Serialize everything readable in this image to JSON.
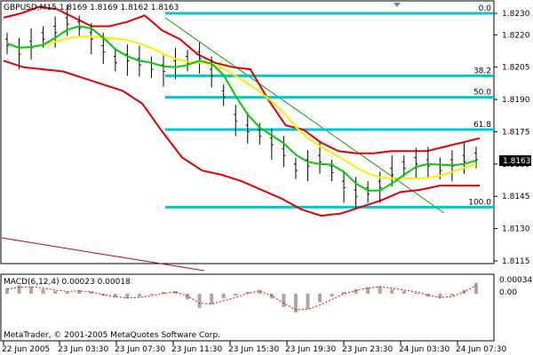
{
  "header": {
    "symbol_info": "GBPUSD,M15  1.8169 1.8169 1.8162 1.8163"
  },
  "indicator": {
    "label": "MACD(6,12,4) 0.00023 0.00018",
    "levels": [
      "0.00034",
      "0.00"
    ]
  },
  "footer": {
    "copyright": "MetaTrader, © 2001-2005 MetaQuotes Software Corp."
  },
  "current_price": "1.8163",
  "colors": {
    "fibo": "#00c8d0",
    "bands": "#e00000",
    "ma_fast": "#00cc00",
    "ma_slow": "#ffee00",
    "candles": "#000000",
    "trendline_green": "#00a000",
    "trendline_red": "#c00000",
    "macd_hist": "#a8a8a8",
    "macd_signal": "#e00000"
  },
  "chart_data": [
    {
      "type": "line",
      "series_visual": "OHLC bars with Bollinger bands, moving averages and Fibonacci retracement levels",
      "x_tick_labels": [
        "22 Jun 2005",
        "23 Jun 03:30",
        "23 Jun 07:30",
        "23 Jun 11:30",
        "23 Jun 15:30",
        "23 Jun 19:30",
        "23 Jun 23:30",
        "24 Jun 03:30",
        "24 Jun 07:30"
      ],
      "y_tick_labels": [
        "1.8230",
        "1.8220",
        "1.8205",
        "1.8190",
        "1.8175",
        "1.8160",
        "1.8145",
        "1.8130",
        "1.8115"
      ],
      "ylim": [
        1.811,
        1.8237
      ],
      "fibonacci_levels": [
        {
          "label": "0.0",
          "price": 1.823
        },
        {
          "label": "38.2",
          "price": 1.8201
        },
        {
          "label": "50.0",
          "price": 1.8191
        },
        {
          "label": "61.8",
          "price": 1.8176
        },
        {
          "label": "100.0",
          "price": 1.814
        }
      ],
      "price_series": [
        1.8216,
        1.8212,
        1.8215,
        1.8219,
        1.8222,
        1.8226,
        1.8224,
        1.8219,
        1.8213,
        1.8208,
        1.8209,
        1.8207,
        1.8205,
        1.8204,
        1.8206,
        1.8208,
        1.821,
        1.8202,
        1.8192,
        1.8181,
        1.8176,
        1.8174,
        1.817,
        1.8165,
        1.8158,
        1.816,
        1.8162,
        1.8157,
        1.815,
        1.8146,
        1.8147,
        1.815,
        1.8156,
        1.8159,
        1.8161,
        1.816,
        1.8158,
        1.816,
        1.8162,
        1.8163
      ],
      "upper_band": [
        1.8228,
        1.823,
        1.8233,
        1.8232,
        1.8228,
        1.8224,
        1.8224,
        1.8226,
        1.8229,
        1.8222,
        1.8218,
        1.8211,
        1.8207,
        1.8205,
        1.8204,
        1.819,
        1.8178,
        1.8176,
        1.817,
        1.8166,
        1.8165,
        1.8165,
        1.8166,
        1.8166,
        1.8166,
        1.8168,
        1.817,
        1.8172
      ],
      "lower_band": [
        1.8208,
        1.8205,
        1.8204,
        1.8203,
        1.82,
        1.8197,
        1.8194,
        1.8188,
        1.8175,
        1.8163,
        1.8157,
        1.8155,
        1.8152,
        1.8148,
        1.8144,
        1.8139,
        1.8136,
        1.8137,
        1.814,
        1.8143,
        1.8147,
        1.8148,
        1.815,
        1.815,
        1.815
      ],
      "current_price": 1.8163
    },
    {
      "type": "bar",
      "title": "MACD(6,12,4) 0.00023 0.00018",
      "ylim": [
        -0.0006,
        0.00034
      ],
      "y_tick_labels": [
        "0.00034",
        "0.00"
      ],
      "values": [
        0.00012,
        0.00018,
        0.00015,
        0.0001,
        6e-05,
        4e-05,
        8e-05,
        5e-05,
        -4e-05,
        -8e-05,
        -0.0001,
        -6e-05,
        -2e-05,
        4e-05,
        6e-05,
        -0.00012,
        -0.0003,
        -0.00022,
        -0.0001,
        -4e-05,
        4e-05,
        8e-05,
        -0.0001,
        -0.00028,
        -0.0004,
        -0.00032,
        -0.00018,
        -6e-05,
        4e-05,
        0.0001,
        0.00014,
        0.00016,
        0.0001,
        6e-05,
        2e-05,
        -6e-05,
        -0.0001,
        -4e-05,
        8e-05,
        0.00023
      ],
      "signal": [
        0.0001,
        0.00014,
        0.00015,
        0.00012,
        8e-05,
        5e-05,
        6e-05,
        4e-05,
        -2e-05,
        -6e-05,
        -9e-05,
        -8e-05,
        -4e-05,
        1e-05,
        4e-05,
        -5e-05,
        -0.0002,
        -0.00022,
        -0.00015,
        -8e-05,
        1e-05,
        6e-05,
        -4e-05,
        -0.0002,
        -0.00034,
        -0.00033,
        -0.00024,
        -0.00012,
        0.0,
        7e-05,
        0.00012,
        0.00015,
        0.00012,
        8e-05,
        4e-05,
        -3e-05,
        -8e-05,
        -6e-05,
        4e-05,
        0.00018
      ]
    }
  ]
}
